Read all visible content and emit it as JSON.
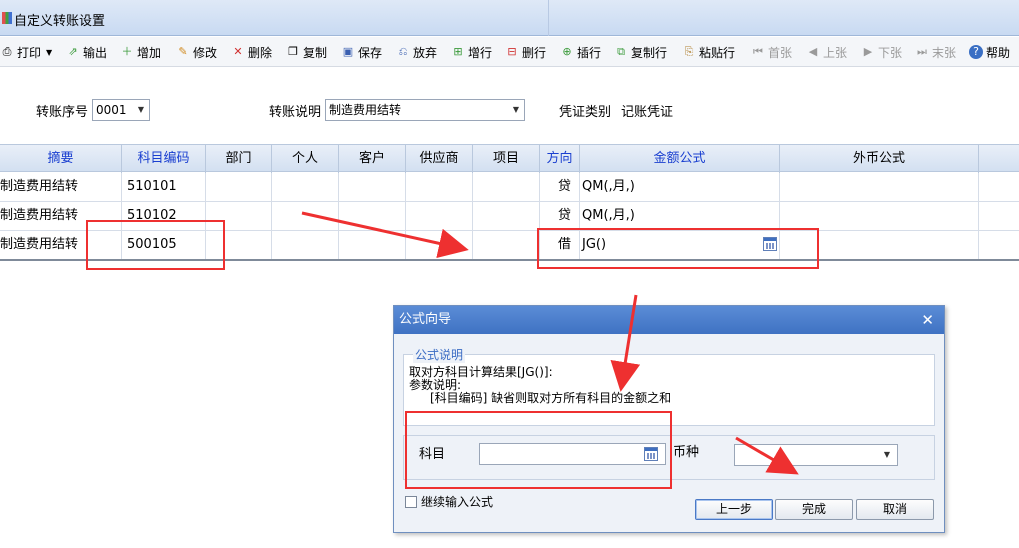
{
  "window": {
    "title": "自定义转账设置"
  },
  "toolbar": {
    "items": [
      {
        "label": "打印",
        "icon": "printer-icon"
      },
      {
        "label": "输出",
        "icon": "export-icon"
      },
      {
        "label": "增加",
        "icon": "add-icon"
      },
      {
        "label": "修改",
        "icon": "edit-icon"
      },
      {
        "label": "删除",
        "icon": "delete-icon"
      },
      {
        "label": "复制",
        "icon": "copy-icon"
      },
      {
        "label": "保存",
        "icon": "save-icon"
      },
      {
        "label": "放弃",
        "icon": "discard-icon"
      },
      {
        "label": "增行",
        "icon": "add-row-icon"
      },
      {
        "label": "删行",
        "icon": "delete-row-icon"
      },
      {
        "label": "插行",
        "icon": "insert-row-icon"
      },
      {
        "label": "复制行",
        "icon": "copy-row-icon"
      },
      {
        "label": "粘贴行",
        "icon": "paste-row-icon"
      },
      {
        "label": "首张",
        "icon": "first-icon"
      },
      {
        "label": "上张",
        "icon": "prev-icon"
      },
      {
        "label": "下张",
        "icon": "next-icon"
      },
      {
        "label": "末张",
        "icon": "last-icon"
      },
      {
        "label": "帮助",
        "icon": "help-icon"
      }
    ]
  },
  "form": {
    "seq_label": "转账序号",
    "seq_value": "0001",
    "desc_label": "转账说明",
    "desc_value": "制造费用结转",
    "voucher_type_label": "凭证类别",
    "voucher_type_value": "记账凭证"
  },
  "grid": {
    "columns": [
      "摘要",
      "科目编码",
      "部门",
      "个人",
      "客户",
      "供应商",
      "项目",
      "方向",
      "金额公式",
      "外币公式"
    ],
    "rows": [
      {
        "summary": "制造费用结转",
        "code": "510101",
        "direction": "贷",
        "formula": "QM(,月,)"
      },
      {
        "summary": "制造费用结转",
        "code": "510102",
        "direction": "贷",
        "formula": "QM(,月,)"
      },
      {
        "summary": "制造费用结转",
        "code": "500105",
        "direction": "借",
        "formula": "JG()"
      }
    ]
  },
  "dialog": {
    "title": "公式向导",
    "section_label": "公式说明",
    "desc_line1": "取对方科目计算结果[JG()]:",
    "desc_line2": "参数说明:",
    "desc_line3": "[科目编码] 缺省则取对方所有科目的金额之和",
    "subject_label": "科目",
    "subject_value": "",
    "currency_label": "币种",
    "currency_value": "",
    "continue_label": "继续输入公式",
    "prev_button": "上一步",
    "finish_button": "完成",
    "cancel_button": "取消"
  },
  "colors": {
    "header_blue_text": "#1a3fd0",
    "annotation_red": "#ee3030",
    "dialog_title": "#4a7fcf"
  }
}
